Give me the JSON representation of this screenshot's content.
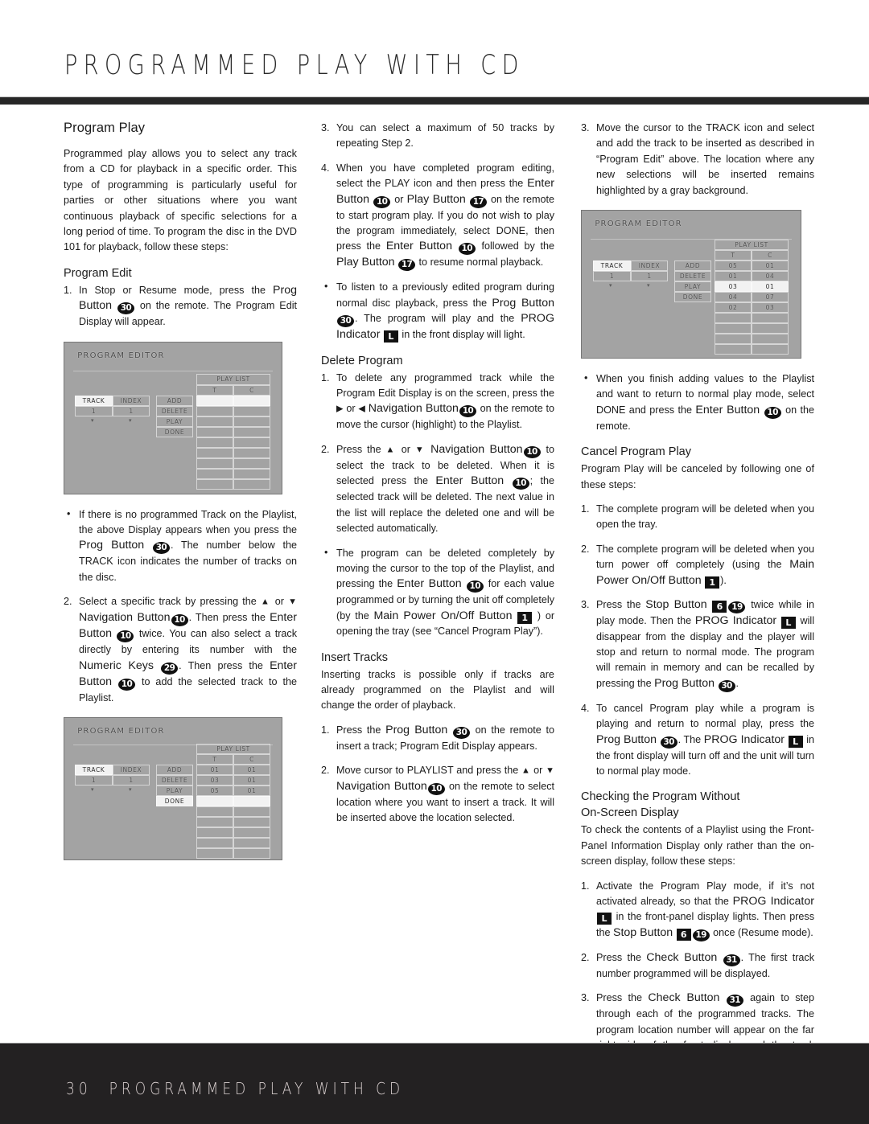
{
  "header": {
    "title": "PROGRAMMED PLAY WITH CD"
  },
  "footer": {
    "page_number": "30",
    "title": "PROGRAMMED PLAY WITH CD"
  },
  "badges": {
    "prog": "30",
    "enter_nav": "10",
    "play": "17",
    "numeric": "29",
    "check": "31",
    "stop_front": "6",
    "stop_remote": "19",
    "main_power": "1",
    "prog_indicator": "L"
  },
  "column1": {
    "heading": "Program Play",
    "intro": "Programmed play allows you to select any track from a CD for playback in a specific order. This type of programming is particularly useful for parties or other situations where you want continuous playback of specific selections for a long period of time. To program the disc in the DVD 101 for playback, follow these steps:",
    "subheading": "Program Edit",
    "step1": {
      "num": "1.",
      "part_a": "In Stop or Resume mode, press the ",
      "ui_a": "Prog Button",
      "part_b": " on the remote. The Program Edit Display will appear."
    },
    "bullet1": {
      "part_a": "If there is no programmed Track on the Playlist, the above Display appears when you press the ",
      "ui_a": "Prog Button",
      "part_b": ". The number below the TRACK icon indicates the number of tracks on the disc."
    },
    "step2": {
      "num": "2.",
      "part_a": "Select a specific track by pressing the ",
      "arrow_up": "▲",
      "or": " or ",
      "arrow_down": "▼",
      "ui_a": "Navigation Button",
      "part_b": ". Then press the ",
      "ui_b": "Enter Button",
      "part_c": " twice. You can also select a track directly by entering its number with the ",
      "ui_c": "Numeric Keys",
      "part_d": ". Then press the ",
      "ui_d": "Enter Button",
      "part_e": " to add the selected track to the Playlist."
    }
  },
  "column2": {
    "step3": {
      "num": "3.",
      "text": "You can select a maximum of 50 tracks by repeating Step 2."
    },
    "step4": {
      "num": "4.",
      "part_a": "When you have completed program editing, select the PLAY icon and then press the ",
      "ui_a": "Enter Button",
      "part_b": " or ",
      "ui_b": "Play Button",
      "part_c": " on the remote to start program play. If you do not wish to play the program immediately, select DONE, then press the ",
      "ui_c": "Enter Button",
      "part_d": " followed by the ",
      "ui_d": "Play Button",
      "part_e": " to resume normal playback."
    },
    "bullet1": {
      "part_a": "To listen to a previously edited program during normal disc playback, press the ",
      "ui_a": "Prog Button",
      "part_b": ". The program will play and the ",
      "ui_b": "PROG Indicator",
      "part_c": " in the front display will light."
    },
    "delete_heading": "Delete Program",
    "delete_step1": {
      "num": "1.",
      "part_a": "To delete any programmed track while the Program Edit Display is on the screen, press the ",
      "arrow_right": "▶",
      "or": "  or  ",
      "arrow_left": "◀",
      "ui_a": "Navigation Button",
      "part_b": " on the remote to move the cursor (highlight) to the Playlist."
    },
    "delete_step2": {
      "num": "2.",
      "part_a": "Press the ",
      "arrow_up": "▲",
      "or": " or ",
      "arrow_down": "▼",
      "ui_a": "Navigation Button",
      "part_b": " to select the track to be deleted. When it is selected press the ",
      "ui_b": "Enter Button",
      "part_c": "; the selected track will be deleted. The next value in the list will replace the deleted one and will be selected automatically."
    },
    "delete_bullet": {
      "part_a": "The program can be deleted completely by moving the cursor to the top of the Playlist, and pressing the ",
      "ui_a": "Enter Button",
      "part_b": " for each value programmed or by turning the unit off completely (by the ",
      "ui_b": "Main Power On/Off Button",
      "part_c": " ) or opening the tray (see “Cancel Program Play”)."
    },
    "insert_heading": "Insert Tracks",
    "insert_intro": "Inserting tracks is possible only if tracks are already programmed on the Playlist and will change the order of playback.",
    "insert_step1": {
      "num": "1.",
      "part_a": "Press the ",
      "ui_a": "Prog Button",
      "part_b": " on the remote to insert a track; Program Edit Display appears."
    },
    "insert_step2": {
      "num": "2.",
      "part_a": "Move cursor to PLAYLIST and press the ",
      "arrow_up": "▲",
      "or": " or ",
      "arrow_down": "▼",
      "ui_a": "Navigation Button",
      "part_b": " on the remote to select location where you want to insert a track. It will be inserted above the location selected."
    }
  },
  "column3": {
    "insert_step3": {
      "num": "3.",
      "text": "Move the cursor to the TRACK icon and select and add the track to be inserted as described in “Program Edit” above. The location where any new selections will be inserted remains highlighted by a gray background."
    },
    "bullet1": {
      "part_a": "When you finish adding values to the Playlist and want to return to normal play mode, select DONE and press the ",
      "ui_a": "Enter Button",
      "part_b": " on the remote."
    },
    "cancel_heading": "Cancel Program Play",
    "cancel_intro": "Program Play will be canceled by following one of these steps:",
    "cancel_step1": {
      "num": "1.",
      "text": "The complete program will be deleted when you open the tray."
    },
    "cancel_step2": {
      "num": "2.",
      "part_a": "The complete program will be deleted when you turn power off completely (using the ",
      "ui_a": "Main Power On/Off Button",
      "part_b": ")."
    },
    "cancel_step3": {
      "num": "3.",
      "part_a": "Press the ",
      "ui_a": "Stop Button",
      "part_b": " twice while in play mode. Then the ",
      "ui_b": "PROG Indicator",
      "part_c": " will disappear from the display and the player will stop and return to normal mode. The program will remain in memory and can be recalled by pressing the ",
      "ui_c": "Prog Button",
      "part_d": "."
    },
    "cancel_step4": {
      "num": "4.",
      "part_a": "To cancel Program play while a program is playing and return to normal play, press the ",
      "ui_a": "Prog Button",
      "part_b": ". The ",
      "ui_b": "PROG Indicator",
      "part_c": " in the front display will turn off and the unit will turn to normal play mode."
    },
    "checking_heading_line1": "Checking the Program Without",
    "checking_heading_line2": "On-Screen Display",
    "checking_intro": "To check the contents of a Playlist using the Front-Panel Information Display only rather than the on-screen display, follow these steps:",
    "checking_step1": {
      "num": "1.",
      "part_a": "Activate the Program Play mode, if it’s not activated already, so that the ",
      "ui_a": "PROG Indicator",
      "part_b": " in the front-panel display lights. Then press the ",
      "ui_b": "Stop Button",
      "part_c": " once (Resume mode)."
    },
    "checking_step2": {
      "num": "2.",
      "part_a": "Press the ",
      "ui_a": "Check Button",
      "part_b": ". The first track number programmed will be displayed."
    },
    "checking_step3": {
      "num": "3.",
      "part_a": "Press the ",
      "ui_a": "Check Button",
      "part_b": " again to step through each of the programmed tracks. The program location number will appear on the far right side of the front display and the track number will appear on the left side."
    }
  },
  "osd_screens": [
    {
      "id": "program-editor-empty",
      "title": "PROGRAM EDITOR",
      "left_labels": [
        "TRACK",
        "INDEX"
      ],
      "left_values": [
        "1",
        "1"
      ],
      "menu": [
        "ADD",
        "DELETE",
        "PLAY",
        "DONE"
      ],
      "playlist_title": "PLAY LIST",
      "playlist_headers": [
        "T",
        "C"
      ],
      "playlist_rows": [
        [
          "",
          ""
        ],
        [
          "",
          ""
        ],
        [
          "",
          ""
        ],
        [
          "",
          ""
        ],
        [
          "",
          ""
        ],
        [
          "",
          ""
        ],
        [
          "",
          ""
        ],
        [
          "",
          ""
        ],
        [
          "",
          ""
        ]
      ],
      "highlight_cell": "TRACK",
      "highlight_row": 0
    },
    {
      "id": "program-editor-three-tracks",
      "title": "PROGRAM EDITOR",
      "left_labels": [
        "TRACK",
        "INDEX"
      ],
      "left_values": [
        "1",
        "1"
      ],
      "menu": [
        "ADD",
        "DELETE",
        "PLAY",
        "DONE"
      ],
      "playlist_title": "PLAY LIST",
      "playlist_headers": [
        "T",
        "C"
      ],
      "playlist_rows": [
        [
          "01",
          "01"
        ],
        [
          "03",
          "01"
        ],
        [
          "05",
          "01"
        ],
        [
          "",
          ""
        ],
        [
          "",
          ""
        ],
        [
          "",
          ""
        ],
        [
          "",
          ""
        ],
        [
          "",
          ""
        ],
        [
          "",
          ""
        ]
      ],
      "highlight_cell": "TRACK",
      "highlight_menu": "DONE",
      "highlight_row": 3
    },
    {
      "id": "program-editor-inserting",
      "title": "PROGRAM EDITOR",
      "left_labels": [
        "TRACK",
        "INDEX"
      ],
      "left_values": [
        "1",
        "1"
      ],
      "menu": [
        "ADD",
        "DELETE",
        "PLAY",
        "DONE"
      ],
      "playlist_title": "PLAY LIST",
      "playlist_headers": [
        "T",
        "C"
      ],
      "playlist_rows": [
        [
          "05",
          "01"
        ],
        [
          "01",
          "04"
        ],
        [
          "03",
          "01"
        ],
        [
          "04",
          "07"
        ],
        [
          "02",
          "03"
        ],
        [
          "",
          ""
        ],
        [
          "",
          ""
        ],
        [
          "",
          ""
        ],
        [
          "",
          ""
        ]
      ],
      "highlight_cell": "TRACK",
      "highlight_row": 2
    }
  ]
}
